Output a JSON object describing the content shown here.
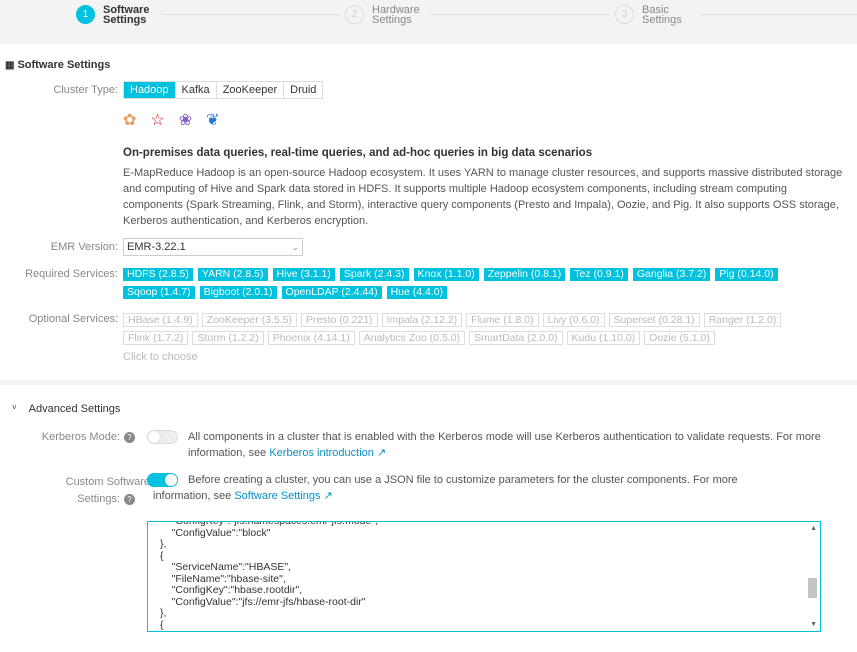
{
  "steps": [
    {
      "num": "1",
      "label": "Software Settings"
    },
    {
      "num": "2",
      "label": "Hardware Settings"
    },
    {
      "num": "3",
      "label": "Basic Settings"
    }
  ],
  "section_title": "Software Settings",
  "cluster_type": {
    "label": "Cluster Type:",
    "options": [
      "Hadoop",
      "Kafka",
      "ZooKeeper",
      "Druid"
    ],
    "selected": "Hadoop"
  },
  "description": {
    "title": "On-premises data queries, real-time queries, and ad-hoc queries in big data scenarios",
    "text": "E-MapReduce Hadoop is an open-source Hadoop ecosystem. It uses YARN to manage cluster resources, and supports massive distributed storage and computing of Hive and Spark data stored in HDFS. It supports multiple Hadoop ecosystem components, including stream computing components (Spark Streaming, Flink, and Storm), interactive query components (Presto and Impala), Oozie, and Pig. It also supports OSS storage, Kerberos authentication, and Kerberos encryption."
  },
  "emr_version": {
    "label": "EMR Version:",
    "value": "EMR-3.22.1"
  },
  "required": {
    "label": "Required Services:",
    "items": [
      "HDFS (2.8.5)",
      "YARN (2.8.5)",
      "Hive (3.1.1)",
      "Spark (2.4.3)",
      "Knox (1.1.0)",
      "Zeppelin (0.8.1)",
      "Tez (0.9.1)",
      "Ganglia (3.7.2)",
      "Pig (0.14.0)",
      "Sqoop (1.4.7)",
      "Bigboot (2.0.1)",
      "OpenLDAP (2.4.44)",
      "Hue (4.4.0)"
    ]
  },
  "optional": {
    "label": "Optional Services:",
    "items": [
      "HBase (1.4.9)",
      "ZooKeeper (3.5.5)",
      "Presto (0.221)",
      "Impala (2.12.2)",
      "Flume (1.8.0)",
      "Livy (0.6.0)",
      "Superset (0.28.1)",
      "Ranger (1.2.0)",
      "Flink (1.7.2)",
      "Storm (1.2.2)",
      "Phoenix (4.14.1)",
      "Analytics Zoo (0.5.0)",
      "SmartData (2.0.0)",
      "Kudu (1.10.0)",
      "Oozie (5.1.0)"
    ],
    "hint": "Click to choose"
  },
  "advanced": {
    "title": "Advanced Settings",
    "kerberos": {
      "label": "Kerberos Mode:",
      "enabled": false,
      "text": "All components in a cluster that is enabled with the Kerberos mode will use Kerberos authentication to validate requests. For more information, see ",
      "link": "Kerberos introduction"
    },
    "custom": {
      "label1": "Custom Software",
      "label2": "Settings:",
      "enabled": true,
      "text": "Before creating a cluster, you can use a JSON file to customize parameters for the cluster components. For more information, see ",
      "link": "Software Settings"
    },
    "json": "    \"ConfigKey\":\"jfs.namespaces.emr-jfs.mode\",\n    \"ConfigValue\":\"block\"\n},\n{\n    \"ServiceName\":\"HBASE\",\n    \"FileName\":\"hbase-site\",\n    \"ConfigKey\":\"hbase.rootdir\",\n    \"ConfigValue\":\"jfs://emr-jfs/hbase-root-dir\"\n},\n{"
  }
}
